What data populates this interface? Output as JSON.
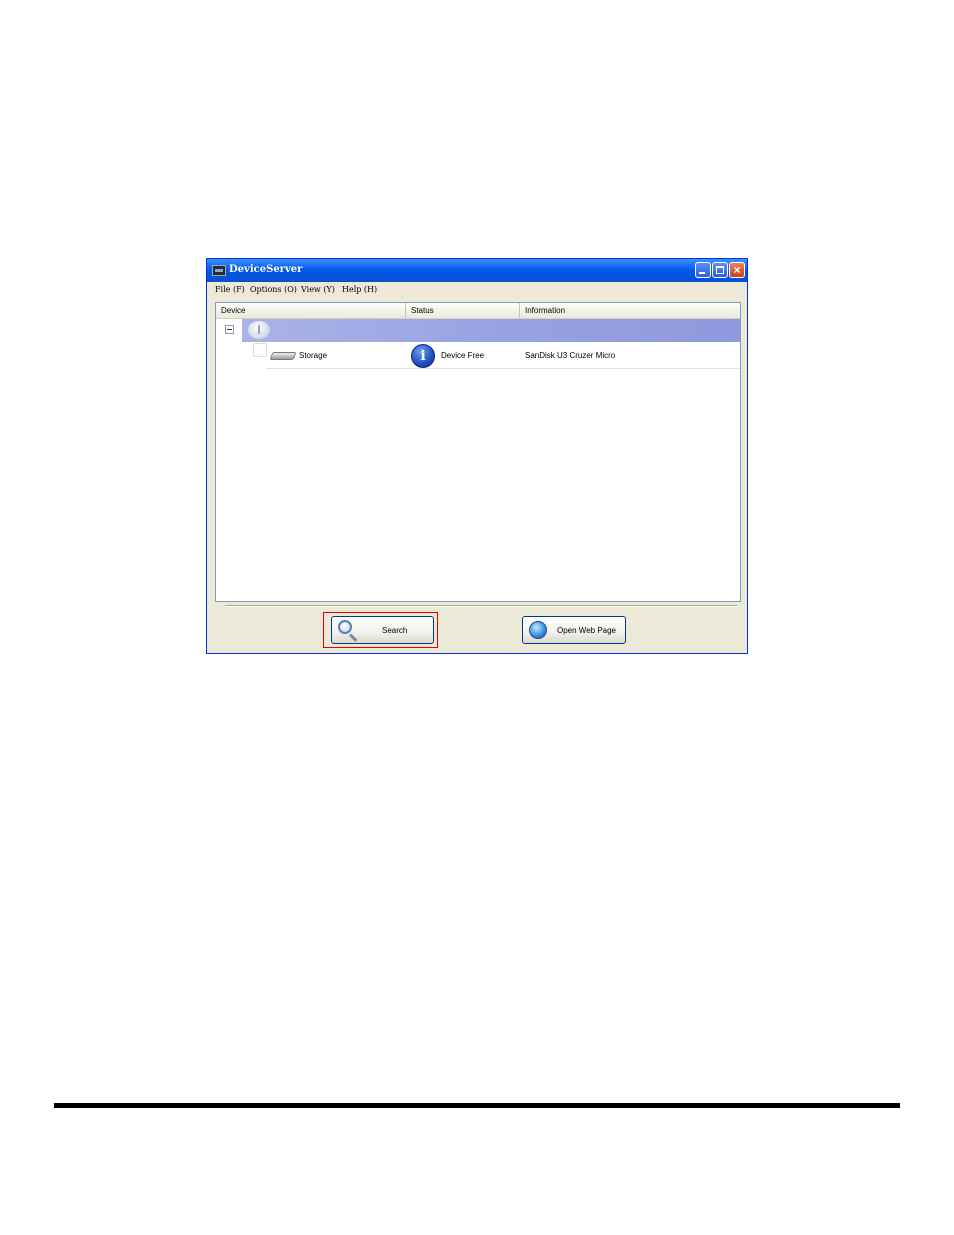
{
  "window": {
    "title": "DeviceServer"
  },
  "menu": {
    "items": [
      "File (F)",
      "Options (O)",
      "View (Y)",
      "Help (H)"
    ]
  },
  "list": {
    "columns": [
      "Device",
      "Status",
      "Information"
    ],
    "rows": [
      {
        "device": "Storage",
        "status": "Device Free",
        "information": "SanDisk U3 Cruzer Micro"
      }
    ]
  },
  "buttons": {
    "search": "Search",
    "open_web_page": "Open Web Page"
  },
  "colors": {
    "title_bar": "#0054e3",
    "group_row": "#98a3e2",
    "highlight": "#e00000"
  },
  "icons": {
    "group": "usb-icon",
    "device": "storage-drive-icon",
    "status": "info-icon",
    "search": "magnifier-icon",
    "web": "globe-icon"
  }
}
